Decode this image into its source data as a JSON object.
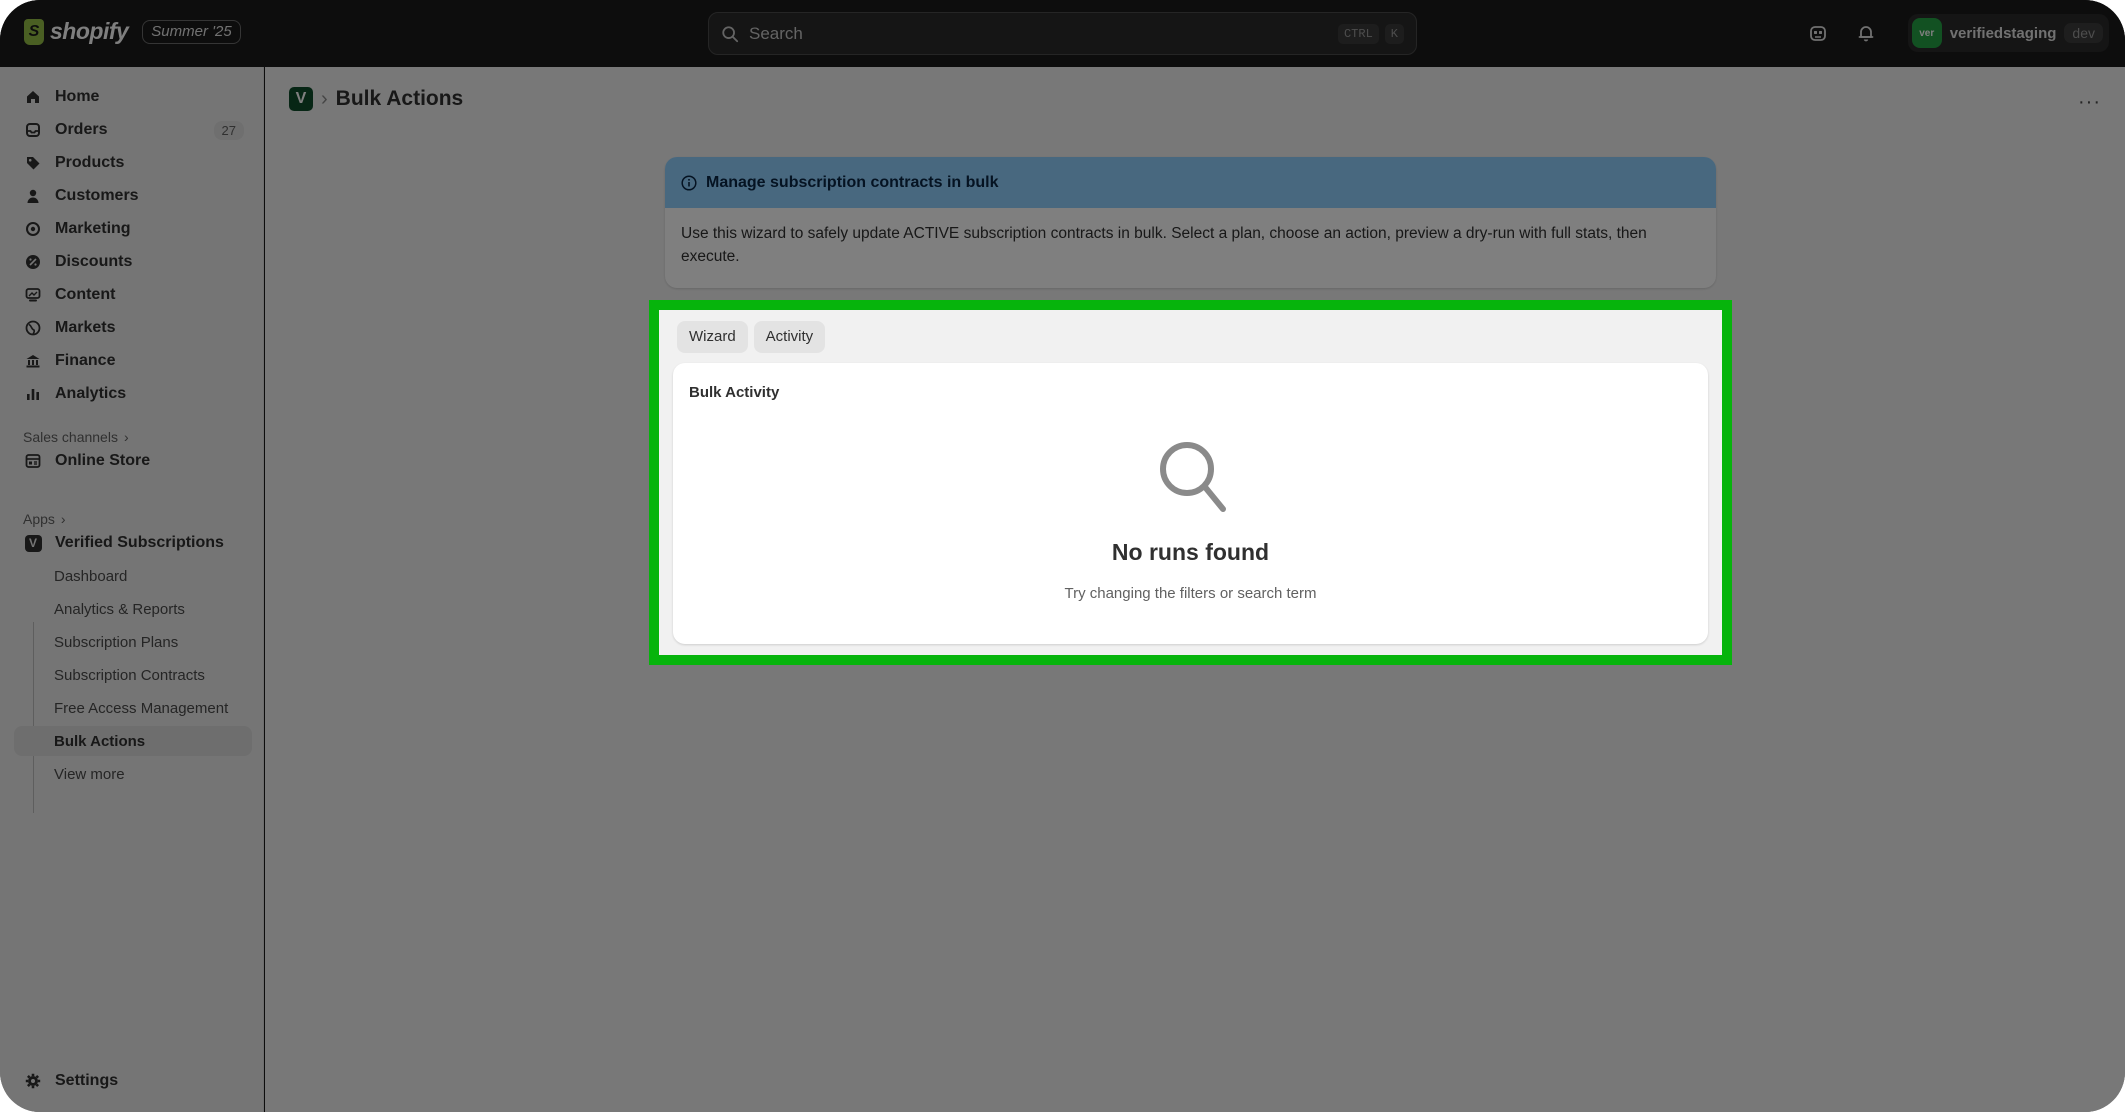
{
  "topbar": {
    "brand": "shopify",
    "brand_glyph": "S",
    "edition": "Summer '25",
    "search_placeholder": "Search",
    "shortcut_keys": [
      "CTRL",
      "K"
    ],
    "store_avatar": "ver",
    "store_name": "verifiedstaging",
    "store_env": "dev"
  },
  "sidebar": {
    "items": [
      {
        "label": "Home",
        "icon": "home-icon"
      },
      {
        "label": "Orders",
        "icon": "orders-icon",
        "count": "27"
      },
      {
        "label": "Products",
        "icon": "tag-icon"
      },
      {
        "label": "Customers",
        "icon": "person-icon"
      },
      {
        "label": "Marketing",
        "icon": "target-icon"
      },
      {
        "label": "Discounts",
        "icon": "discount-icon"
      },
      {
        "label": "Content",
        "icon": "content-icon"
      },
      {
        "label": "Markets",
        "icon": "globe-icon"
      },
      {
        "label": "Finance",
        "icon": "bank-icon"
      },
      {
        "label": "Analytics",
        "icon": "bar-chart-icon"
      }
    ],
    "sales_channels_label": "Sales channels",
    "online_store": "Online Store",
    "apps_label": "Apps",
    "app_name": "Verified Subscriptions",
    "app_glyph": "V",
    "app_subitems": [
      "Dashboard",
      "Analytics & Reports",
      "Subscription Plans",
      "Subscription Contracts",
      "Free Access Management",
      "Bulk Actions",
      "View more"
    ],
    "settings": "Settings"
  },
  "page": {
    "app_glyph": "V",
    "title": "Bulk Actions",
    "more": "···"
  },
  "banner": {
    "title": "Manage subscription contracts in bulk",
    "body": "Use this wizard to safely update ACTIVE subscription contracts in bulk. Select a plan, choose an action, preview a dry-run with full stats, then execute."
  },
  "tabs": [
    "Wizard",
    "Activity"
  ],
  "activity_card": {
    "title": "Bulk Activity",
    "empty_title": "No runs found",
    "empty_subtitle": "Try changing the filters or search term"
  },
  "colors": {
    "highlight": "#06b40c",
    "banner_header": "#91d0ff",
    "topbar": "#1a1a1a",
    "store_avatar": "#25a244"
  }
}
